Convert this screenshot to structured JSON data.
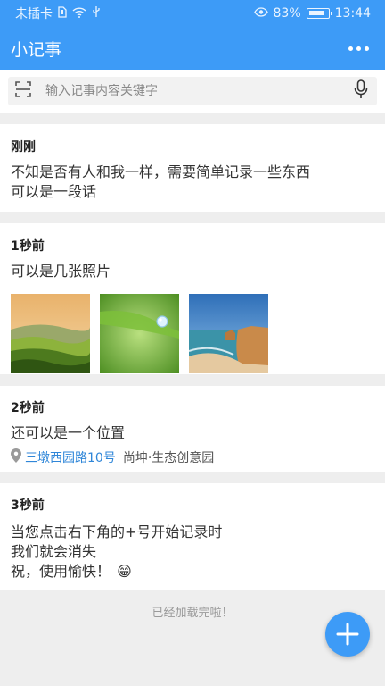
{
  "status_bar": {
    "carrier": "未插卡",
    "battery": "83%",
    "time": "13:44"
  },
  "app": {
    "title": "小记事"
  },
  "search": {
    "placeholder": "输入记事内容关键字"
  },
  "notes": [
    {
      "time": "刚刚",
      "lines": [
        "不知是否有人和我一样，需要简单记录一些东西",
        "可以是一段话"
      ]
    },
    {
      "time": "1秒前",
      "lines": [
        "可以是几张照片"
      ],
      "photos": [
        "field-landscape",
        "water-drop-leaf",
        "coastal-cliffs"
      ]
    },
    {
      "time": "2秒前",
      "lines": [
        "还可以是一个位置"
      ],
      "location": {
        "address": "三墩西园路10号",
        "place": "尚坤·生态创意园"
      }
    },
    {
      "time": "3秒前",
      "lines": [
        "当您点击右下角的+号开始记录时",
        "我们就会消失",
        "祝，使用愉快！"
      ],
      "emoji": "😁"
    }
  ],
  "footer": {
    "text": "已经加载完啦！"
  },
  "colors": {
    "primary": "#3d9bf7",
    "link": "#2f86d8"
  }
}
